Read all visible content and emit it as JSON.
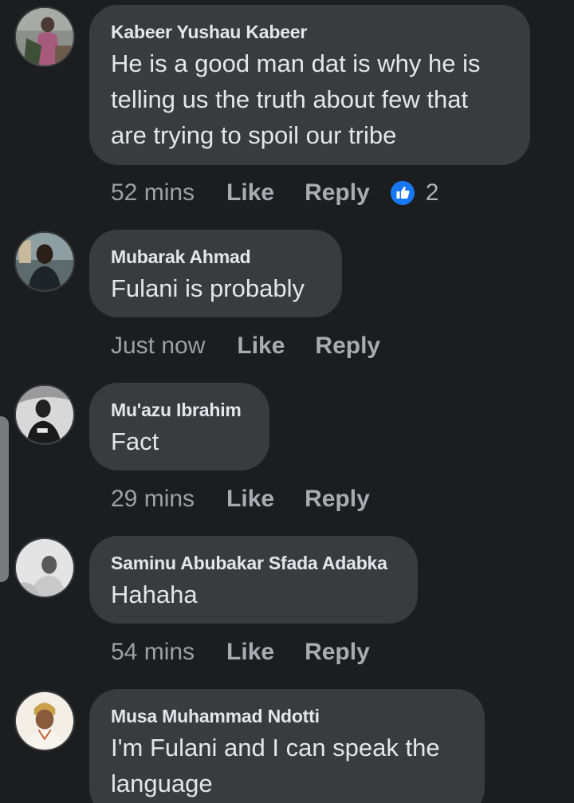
{
  "comments": [
    {
      "author": "Kabeer Yushau Kabeer",
      "text": "He is a good man dat is why he is telling us the truth about few that are trying to spoil our tribe",
      "time": "52 mins",
      "like_label": "Like",
      "reply_label": "Reply",
      "reactions": {
        "icon": "thumbs-up-icon",
        "count": "2"
      },
      "avatar": "avatar-photo"
    },
    {
      "author": "Mubarak Ahmad",
      "text": "Fulani is probably",
      "time": "Just now",
      "like_label": "Like",
      "reply_label": "Reply",
      "avatar": "avatar-photo"
    },
    {
      "author": "Mu'azu Ibrahim",
      "text": "Fact",
      "time": "29 mins",
      "like_label": "Like",
      "reply_label": "Reply",
      "avatar": "avatar-photo"
    },
    {
      "author": "Saminu Abubakar Sfada Adabka",
      "text": "Hahaha",
      "time": "54 mins",
      "like_label": "Like",
      "reply_label": "Reply",
      "avatar": "avatar-photo"
    },
    {
      "author": "Musa Muhammad Ndotti",
      "text": "I'm Fulani and I can speak the language",
      "avatar": "avatar-photo"
    }
  ],
  "colors": {
    "background": "#1c1d1f",
    "bubble": "#3a3b3c",
    "text": "#e4e6eb",
    "meta": "#a8abaf",
    "like_blue": "#1877f2"
  }
}
